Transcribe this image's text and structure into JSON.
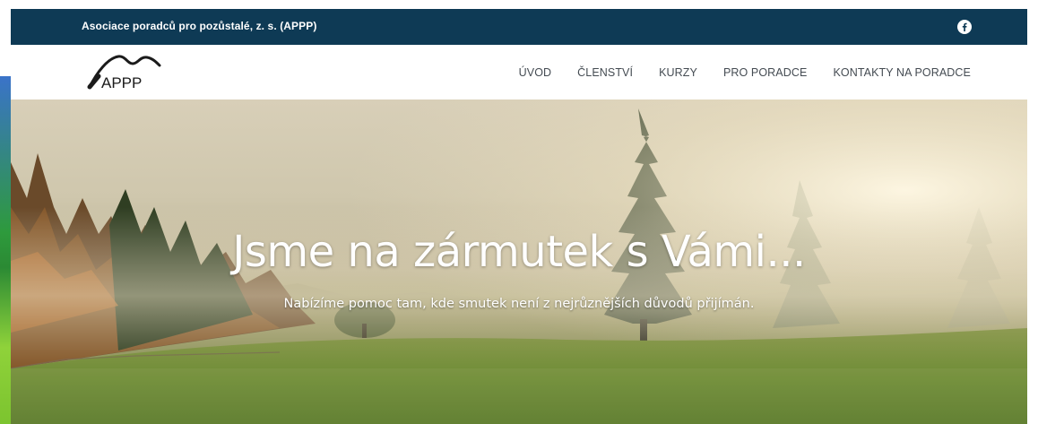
{
  "topbar": {
    "title": "Asociace poradců pro pozůstalé, z. s. (APPP)",
    "social_icon": "facebook-icon"
  },
  "logo": {
    "text": "APPP"
  },
  "nav": {
    "items": [
      {
        "label": "ÚVOD"
      },
      {
        "label": "ČLENSTVÍ"
      },
      {
        "label": "KURZY"
      },
      {
        "label": "PRO PORADCE"
      },
      {
        "label": "KONTAKTY NA PORADCE"
      }
    ]
  },
  "hero": {
    "title": "Jsme na zármutek s Vámi...",
    "subtitle": "Nabízíme pomoc tam, kde smutek není z nejrůznějších důvodů přijímán."
  },
  "colors": {
    "topbar": "#0e3a55",
    "nav_text": "#444b52",
    "hero_text": "#ffffff"
  }
}
